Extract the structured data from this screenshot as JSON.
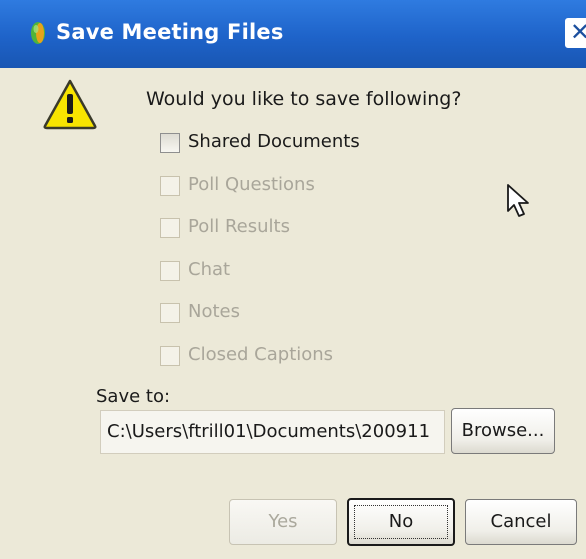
{
  "window": {
    "title": "Save Meeting Files",
    "close_glyph": "✕"
  },
  "icons": {
    "title": "green-orb-icon",
    "warning": "warning-triangle-icon",
    "pointer": "mouse-pointer-icon"
  },
  "dialog": {
    "question": "Would you like to save following?",
    "options": [
      {
        "label": "Shared Documents",
        "checked": false,
        "enabled": true
      },
      {
        "label": "Poll Questions",
        "checked": false,
        "enabled": false
      },
      {
        "label": "Poll Results",
        "checked": false,
        "enabled": false
      },
      {
        "label": "Chat",
        "checked": false,
        "enabled": false
      },
      {
        "label": "Notes",
        "checked": false,
        "enabled": false
      },
      {
        "label": "Closed Captions",
        "checked": false,
        "enabled": false
      }
    ],
    "save_to_label": "Save to:",
    "save_path": "C:\\Users\\ftrill01\\Documents\\200911",
    "browse_label": "Browse...",
    "yes_label": "Yes",
    "no_label": "No",
    "cancel_label": "Cancel"
  },
  "colors": {
    "titlebar": "#1e63c9",
    "dialog_bg": "#ece9d8",
    "warning_yellow": "#f7e400"
  }
}
